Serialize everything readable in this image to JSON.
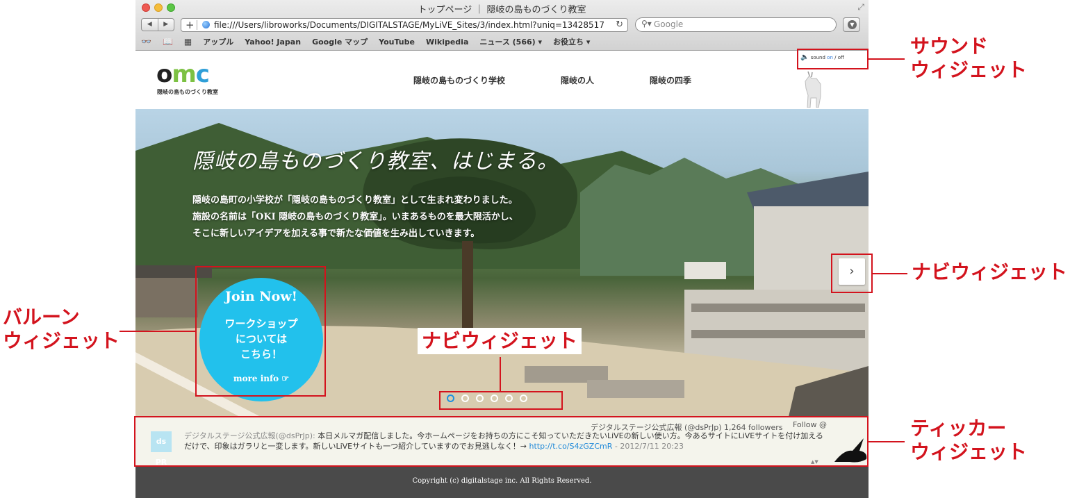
{
  "browser": {
    "window_title": "トップページ ｜ 隠岐の島ものづくり教室",
    "url": "file:///Users/libroworks/Documents/DIGITALSTAGE/MyLiVE_Sites/3/index.html?uniq=13428517",
    "search_placeholder": "Google",
    "bookmarks": [
      "アップル",
      "Yahoo! Japan",
      "Google マップ",
      "YouTube",
      "Wikipedia",
      "ニュース (566) ▾",
      "お役立ち ▾"
    ]
  },
  "site": {
    "logo_text": "omc",
    "logo_subtitle": "隠岐の島ものづくり教室",
    "nav": [
      "隠岐の島ものづくり学校",
      "隠岐の人",
      "隠岐の四季"
    ],
    "sound": {
      "label": "sound",
      "on": "on",
      "sep": "/",
      "off": "off"
    },
    "hero": {
      "title": "隠岐の島ものづくり教室、はじまる。",
      "lines": [
        "隠岐の島町の小学校が「隠岐の島ものづくり教室」として生まれ変わりました。",
        "施設の名前は「OKI 隠岐の島ものづくり教室」。いまあるものを最大限活かし、",
        "そこに新しいアイデアを加える事で新たな価値を生み出していきます。"
      ]
    },
    "balloon": {
      "join": "Join Now!",
      "body": [
        "ワークショップ",
        "については",
        "こちら！"
      ],
      "more": "more info ☞"
    },
    "slider": {
      "dot_count": 6,
      "active_index": 0
    },
    "ticker": {
      "avatar": "ds PR",
      "account": "デジタルステージ公式広報 (@dsPrJp)",
      "followers": "1,264 followers",
      "follow": "Follow @",
      "user": "デジタルステージ公式広報(@dsPrJp):",
      "text": "本日メルマガ配信しました。今ホームページをお持ちの方にこそ知っていただきたいLiVEの新しい使い方。今あるサイトにLiVEサイトを付け加えるだけで、印象はガラリと一変します。新しいLiVEサイトも一つ紹介していますのでお見逃しなく！→",
      "link": "http://t.co/S4zGZCmR",
      "date": "- 2012/7/11 20:23"
    },
    "copyright": "Copyright (c) digitalstage inc. All Rights Reserved."
  },
  "annotations": {
    "sound_widget": [
      "サウンド",
      "ウィジェット"
    ],
    "navi_widget_right": "ナビウィジェット",
    "navi_widget_center": "ナビウィジェット",
    "balloon_widget": [
      "バルーン",
      "ウィジェット"
    ],
    "ticker_widget": [
      "ティッカー",
      "ウィジェット"
    ]
  },
  "colors": {
    "annotation_red": "#d3131d",
    "balloon_cyan": "#22c1ec",
    "active_dot": "#1e90e0",
    "footer": "#4a4a4a"
  }
}
